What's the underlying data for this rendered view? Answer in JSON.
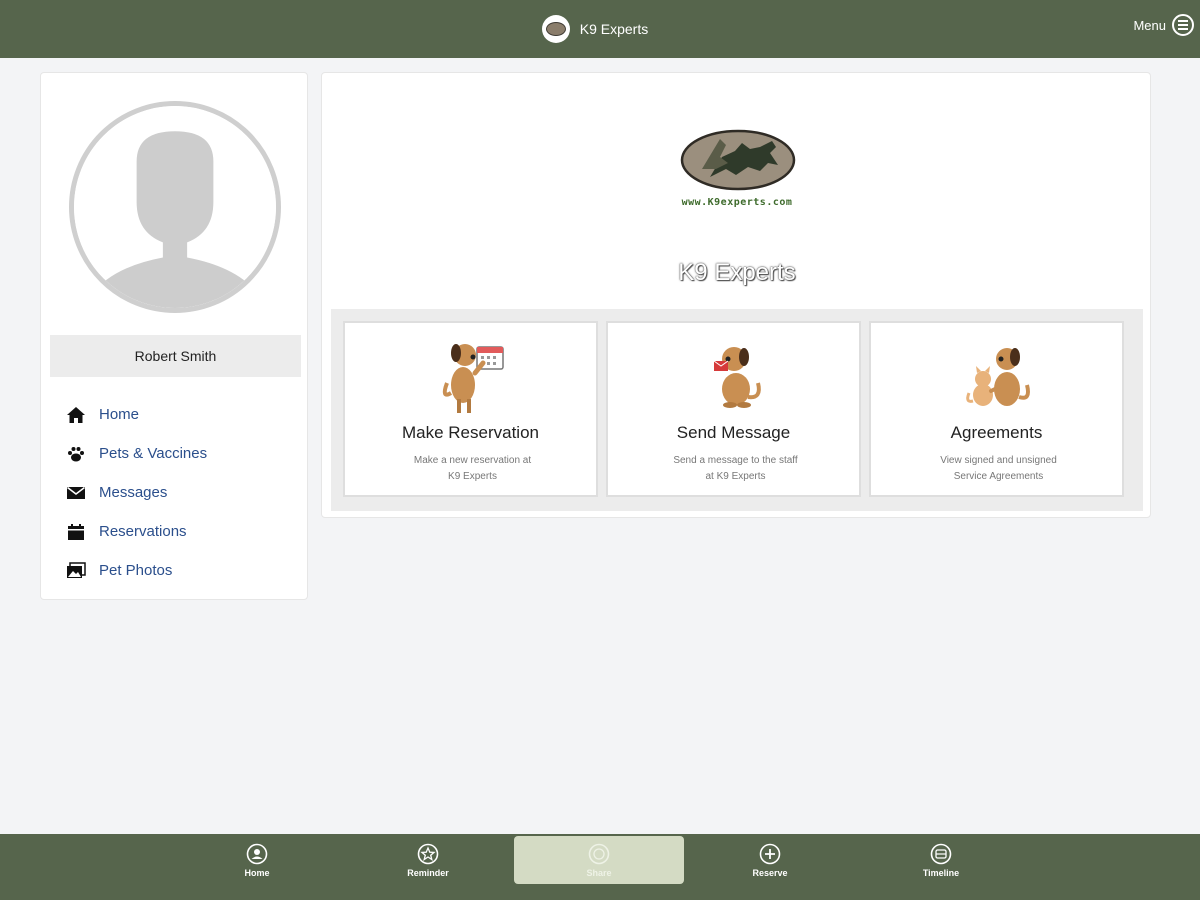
{
  "header": {
    "brand_title": "K9 Experts",
    "menu_label": "Menu"
  },
  "sidebar": {
    "user_name": "Robert Smith",
    "items": [
      {
        "label": "Home",
        "icon": "home-icon"
      },
      {
        "label": "Pets & Vaccines",
        "icon": "paw-icon"
      },
      {
        "label": "Messages",
        "icon": "envelope-icon"
      },
      {
        "label": "Reservations",
        "icon": "calendar-icon"
      },
      {
        "label": "Pet Photos",
        "icon": "photo-icon"
      }
    ]
  },
  "main": {
    "logo_url_text": "www.K9experts.com",
    "hero_title": "K9 Experts",
    "actions": [
      {
        "title": "Make Reservation",
        "desc_line1": "Make a new reservation at",
        "desc_line2": "K9 Experts"
      },
      {
        "title": "Send Message",
        "desc_line1": "Send a message to the staff",
        "desc_line2": "at K9 Experts"
      },
      {
        "title": "Agreements",
        "desc_line1": "View signed and unsigned",
        "desc_line2": "Service Agreements"
      }
    ]
  },
  "bottom_nav": {
    "tabs": [
      {
        "label": "Home",
        "icon": "user-circle-icon"
      },
      {
        "label": "Reminder",
        "icon": "star-circle-icon"
      },
      {
        "label": "Share",
        "icon": "share-circle-icon",
        "active": true
      },
      {
        "label": "Reserve",
        "icon": "plus-circle-icon"
      },
      {
        "label": "Timeline",
        "icon": "timeline-circle-icon"
      }
    ]
  },
  "colors": {
    "bar_green": "#56654c",
    "link_blue": "#2b4f8c",
    "active_tab": "#d4dbc4",
    "dog_brown": "#c98f52"
  }
}
